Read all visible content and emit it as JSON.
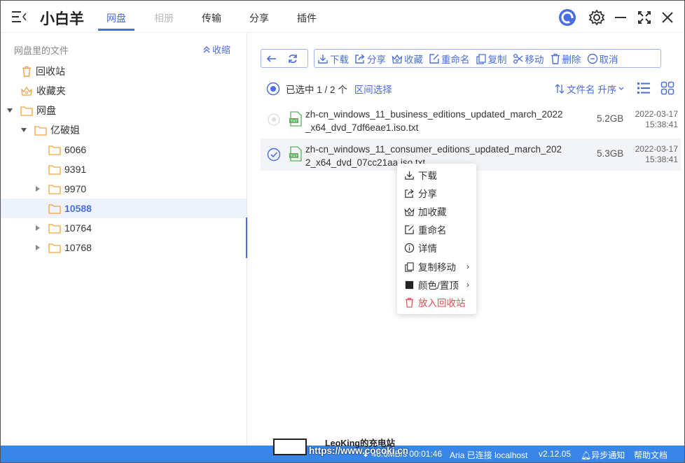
{
  "app": {
    "title": "小白羊"
  },
  "tabs": [
    {
      "label": "网盘"
    },
    {
      "label": "相册"
    },
    {
      "label": "传输"
    },
    {
      "label": "分享"
    },
    {
      "label": "插件"
    }
  ],
  "sidebar": {
    "header": "网盘里的文件",
    "collapse_label": "收缩",
    "items": [
      {
        "label": "回收站"
      },
      {
        "label": "收藏夹"
      },
      {
        "label": "网盘"
      },
      {
        "label": "亿破姐"
      },
      {
        "label": "6066"
      },
      {
        "label": "9391"
      },
      {
        "label": "9970"
      },
      {
        "label": "10588"
      },
      {
        "label": "10764"
      },
      {
        "label": "10768"
      }
    ]
  },
  "toolbar": {
    "download": "下载",
    "share": "分享",
    "favorite": "收藏",
    "rename": "重命名",
    "copy": "复制",
    "move": "移动",
    "delete": "删除",
    "cancel": "取消"
  },
  "selection": {
    "text": "已选中 1 / 2 个",
    "range_select": "区间选择"
  },
  "sort": {
    "label": "文件名 升序"
  },
  "files": [
    {
      "name": "zh-cn_windows_11_business_editions_updated_march_2022_x64_dvd_7df6eae1.iso.txt",
      "size": "5.2GB",
      "date": "2022-03-17",
      "time": "15:38:41",
      "selected": false
    },
    {
      "name": "zh-cn_windows_11_consumer_editions_updated_march_2022_x64_dvd_07cc21aa.iso.txt",
      "size": "5.3GB",
      "date": "2022-03-17",
      "time": "15:38:41",
      "selected": true
    }
  ],
  "context_menu": {
    "download": "下载",
    "share": "分享",
    "add_favorite": "加收藏",
    "rename": "重命名",
    "details": "详情",
    "copy_move": "复制移动",
    "color_pin": "颜色/置顶",
    "trash": "放入回收站"
  },
  "statusbar": {
    "speed": "46.6MB/s 00:01:46",
    "aria": "Aria 已连接 localhost",
    "version": "v2.12.05",
    "async_notify": "异步通知",
    "help": "帮助文档"
  },
  "watermark": {
    "line1": "LeoKing的充电站",
    "line2": "https://www.cocoki.cn"
  },
  "colors": {
    "accent": "#4a6ee0",
    "status_bar": "#3a86e8",
    "folder": "#f2a33a",
    "danger": "#e34d4d",
    "file_green": "#5bb05b"
  }
}
